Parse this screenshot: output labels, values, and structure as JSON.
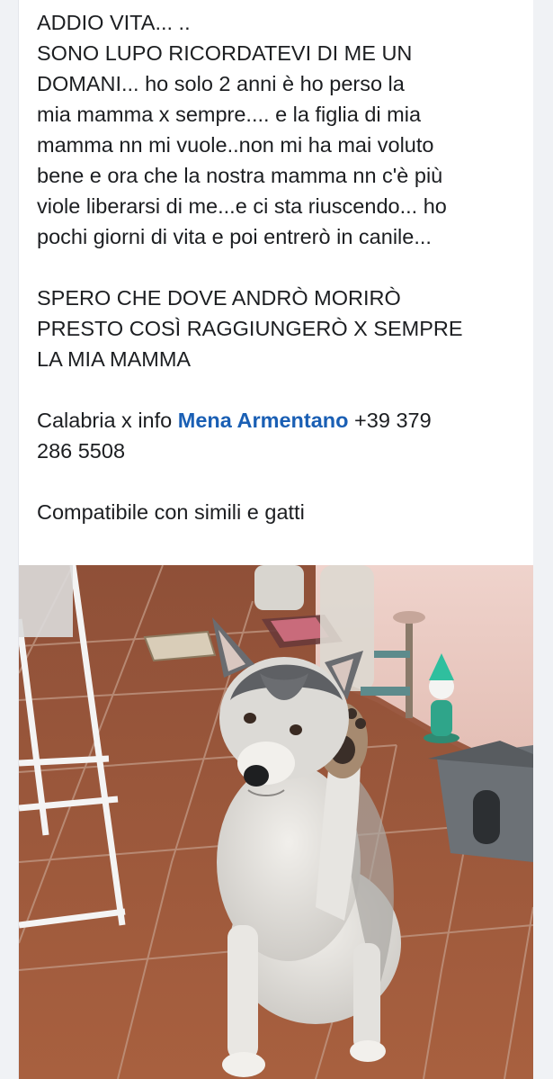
{
  "post": {
    "line_1": "ADDIO VITA... ..",
    "paragraph_1": "SONO LUPO RICORDATEVI DI ME UN\nDOMANI...   ho solo 2 anni è  ho perso la\nmia mamma x sempre.... e la figlia di mia\nmamma nn mi vuole..non mi ha mai voluto\nbene e ora che la nostra mamma nn c'è  più\nviole liberarsi di me...e ci sta riuscendo... ho\npochi giorni di vita e poi entrerò  in canile...",
    "paragraph_2": "SPERO CHE DOVE ANDRÒ MORIRÒ\nPRESTO COSÌ RAGGIUNGERÒ  X SEMPRE\nLA MIA MAMMA",
    "contact_prefix": "Calabria x info ",
    "contact_name": "Mena Armentano",
    "contact_phone": " +39 379\n286 5508",
    "compat": "Compatibile  con simili e gatti"
  },
  "photo": {
    "subject": "husky-dog-raising-paw",
    "colors": {
      "floor": "#a65f3f",
      "floor_dark": "#7e4530",
      "grout": "#c9a58f",
      "wall": "#e9c9c2",
      "fur_light": "#e6e4e0",
      "fur_dark": "#5b5d60",
      "doghouse": "#6e7378"
    }
  }
}
